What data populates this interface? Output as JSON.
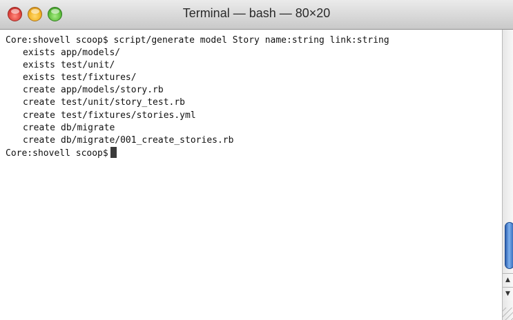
{
  "window": {
    "title": "Terminal — bash — 80×20"
  },
  "terminal": {
    "command_line": {
      "prompt": "Core:shovell scoop$",
      "command": "script/generate model Story name:string link:string"
    },
    "output": [
      {
        "status": "exists",
        "path": "app/models/"
      },
      {
        "status": "exists",
        "path": "test/unit/"
      },
      {
        "status": "exists",
        "path": "test/fixtures/"
      },
      {
        "status": "create",
        "path": "app/models/story.rb"
      },
      {
        "status": "create",
        "path": "test/unit/story_test.rb"
      },
      {
        "status": "create",
        "path": "test/fixtures/stories.yml"
      },
      {
        "status": "create",
        "path": "db/migrate"
      },
      {
        "status": "create",
        "path": "db/migrate/001_create_stories.rb"
      }
    ],
    "final_prompt": "Core:shovell scoop$"
  },
  "icons": {
    "close": "close-button-icon",
    "minimize": "minimize-button-icon",
    "zoom": "zoom-button-icon",
    "scroll_up": "scroll-up-arrow-icon",
    "scroll_down": "scroll-down-arrow-icon"
  },
  "colors": {
    "close": "#e0443e",
    "minimize": "#f2b323",
    "zoom": "#5fc03c",
    "scroll_thumb": "#3b78d8",
    "text": "#111111"
  }
}
